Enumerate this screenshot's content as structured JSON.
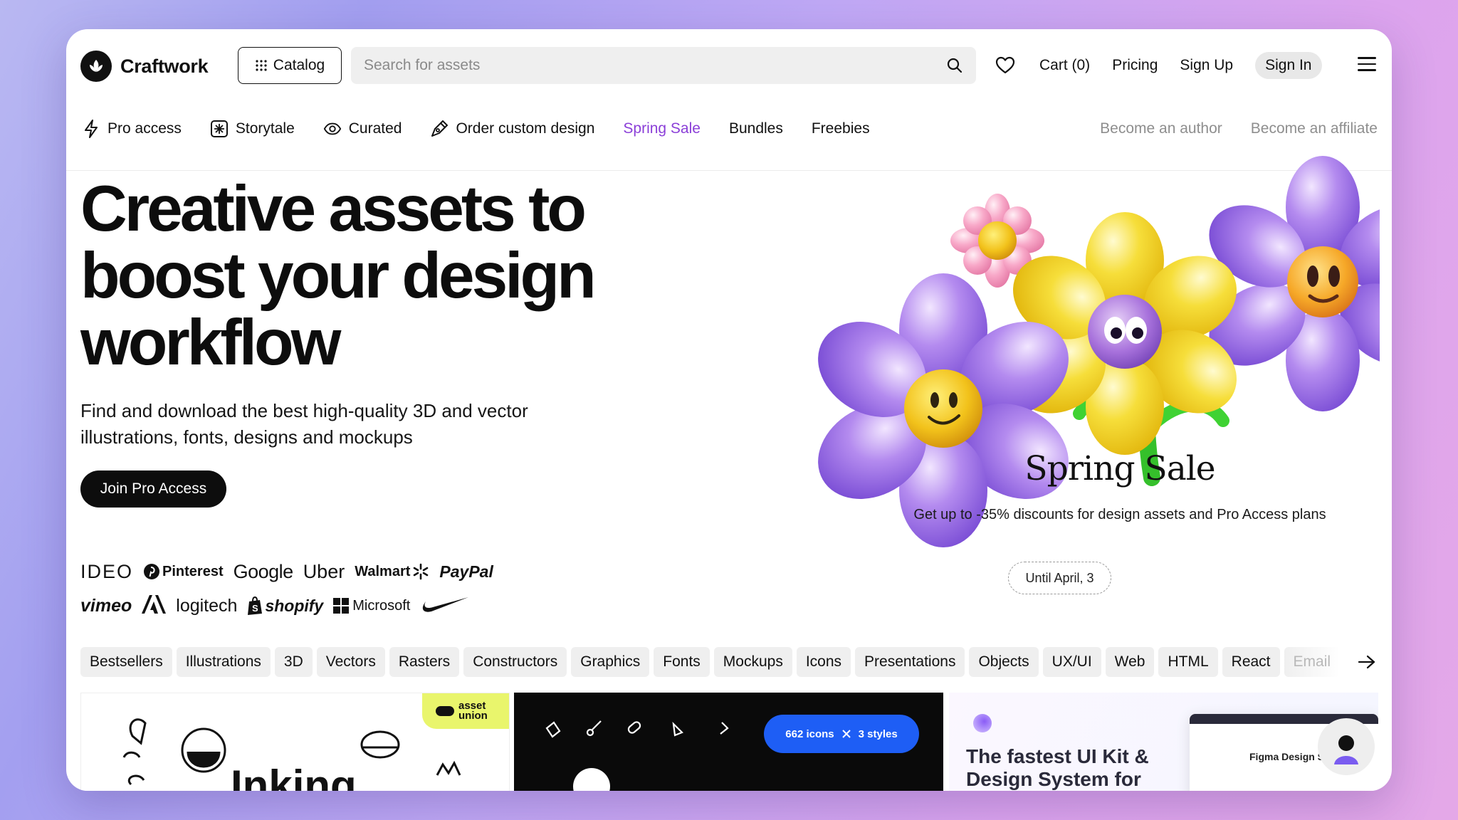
{
  "brand": {
    "name": "Craftwork"
  },
  "header": {
    "catalog_label": "Catalog",
    "search_placeholder": "Search for assets",
    "cart_label": "Cart (0)",
    "pricing_label": "Pricing",
    "signup_label": "Sign Up",
    "signin_label": "Sign In"
  },
  "subnav": {
    "items": [
      {
        "label": "Pro access",
        "icon": "lightning-icon"
      },
      {
        "label": "Storytale",
        "icon": "storytale-icon"
      },
      {
        "label": "Curated",
        "icon": "eye-icon"
      },
      {
        "label": "Order custom design",
        "icon": "pen-tool-icon"
      },
      {
        "label": "Spring Sale",
        "icon": ""
      },
      {
        "label": "Bundles",
        "icon": ""
      },
      {
        "label": "Freebies",
        "icon": ""
      }
    ],
    "become_author": "Become an author",
    "become_affiliate": "Become an affiliate"
  },
  "hero": {
    "title": "Creative assets to boost your design workflow",
    "subtitle": "Find and download the best high-quality 3D and vector illustrations, fonts, designs and mockups",
    "cta": "Join Pro Access"
  },
  "clients": {
    "row1": [
      "IDEO",
      "Pinterest",
      "Google",
      "Uber",
      "Walmart",
      "PayPal"
    ],
    "row2": [
      "vimeo",
      "logitech",
      "shopify",
      "Microsoft"
    ]
  },
  "promo": {
    "title": "Spring Sale",
    "subtitle": "Get up to -35% discounts for design assets and Pro Access plans",
    "until": "Until April, 3"
  },
  "categories": [
    "Bestsellers",
    "Illustrations",
    "3D",
    "Vectors",
    "Rasters",
    "Constructors",
    "Graphics",
    "Fonts",
    "Mockups",
    "Icons",
    "Presentations",
    "Objects",
    "UX/UI",
    "Web",
    "HTML",
    "React",
    "Email"
  ],
  "cards": {
    "card1_badge": "asset union",
    "card2_icons": "662 icons",
    "card2_styles": "3 styles",
    "card3_title": "The fastest UI Kit & Design System for",
    "card3_preview": "Figma Design S"
  },
  "colors": {
    "accent_sale": "#8b3fd8",
    "blue_pill": "#1e5ef5",
    "badge_yellow": "#e9f56c"
  }
}
